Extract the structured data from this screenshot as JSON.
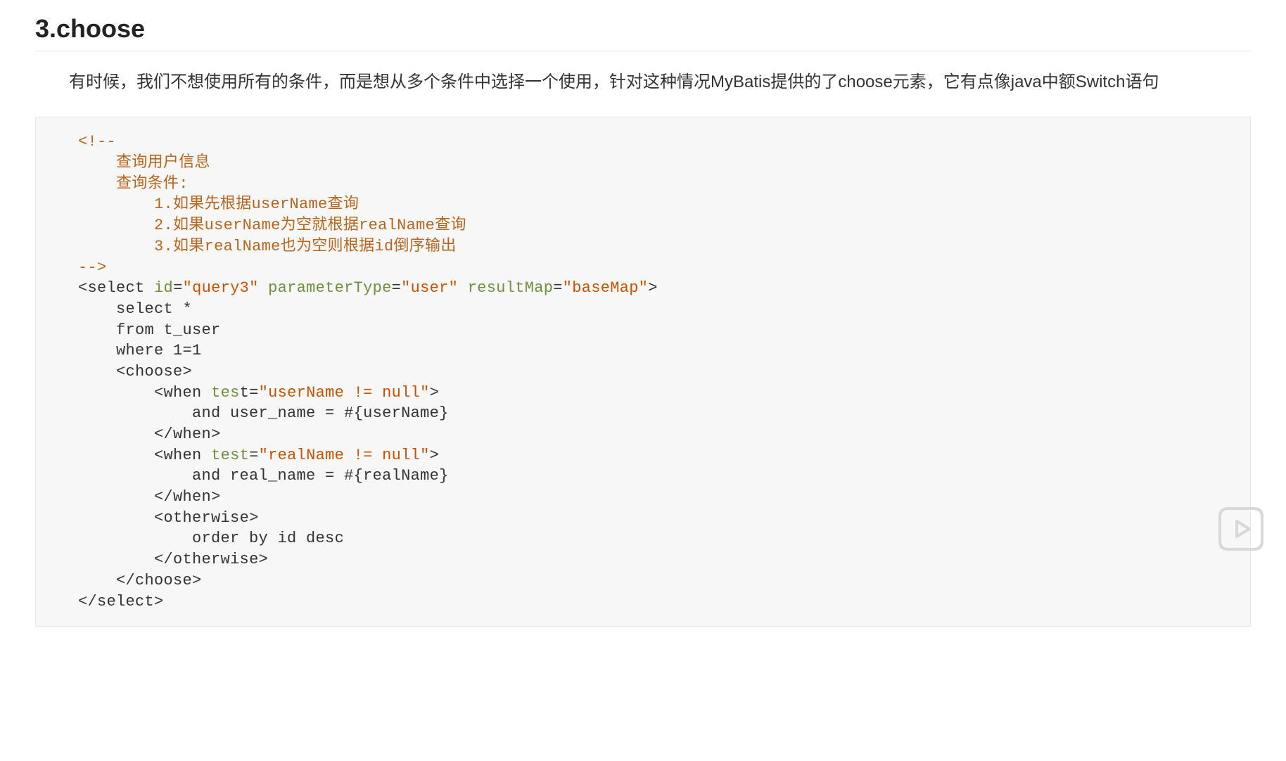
{
  "heading": "3.choose",
  "description": "有时候，我们不想使用所有的条件，而是想从多个条件中选择一个使用，针对这种情况MyBatis提供的了choose元素，它有点像java中额Switch语句",
  "code": {
    "comment_open": "<!--",
    "comment_l1": "查询用户信息",
    "comment_l2": "查询条件:",
    "comment_l3": "1.如果先根据userName查询",
    "comment_l4": "2.如果userName为空就根据realName查询",
    "comment_l5": "3.如果realName也为空则根据id倒序输出",
    "comment_close": "-->",
    "select_open_tag": "select",
    "select_attr_id": "id",
    "select_val_id": "\"query3\"",
    "select_attr_pt": "parameterType",
    "select_val_pt": "\"user\"",
    "select_attr_rm": "resultMap",
    "select_val_rm": "\"baseMap\"",
    "sql_l1": "select *",
    "sql_l2": "from t_user",
    "sql_l3": "where 1=1",
    "choose_tag": "choose",
    "when_tag": "when",
    "when_attr": "test",
    "when_val1": "\"userName != null\"",
    "when_body1": "and user_name = #{userName}",
    "when_val2": "\"realName != null\"",
    "when_body2": "and real_name = #{realName}",
    "otherwise_tag": "otherwise",
    "otherwise_body": "order by id desc"
  }
}
